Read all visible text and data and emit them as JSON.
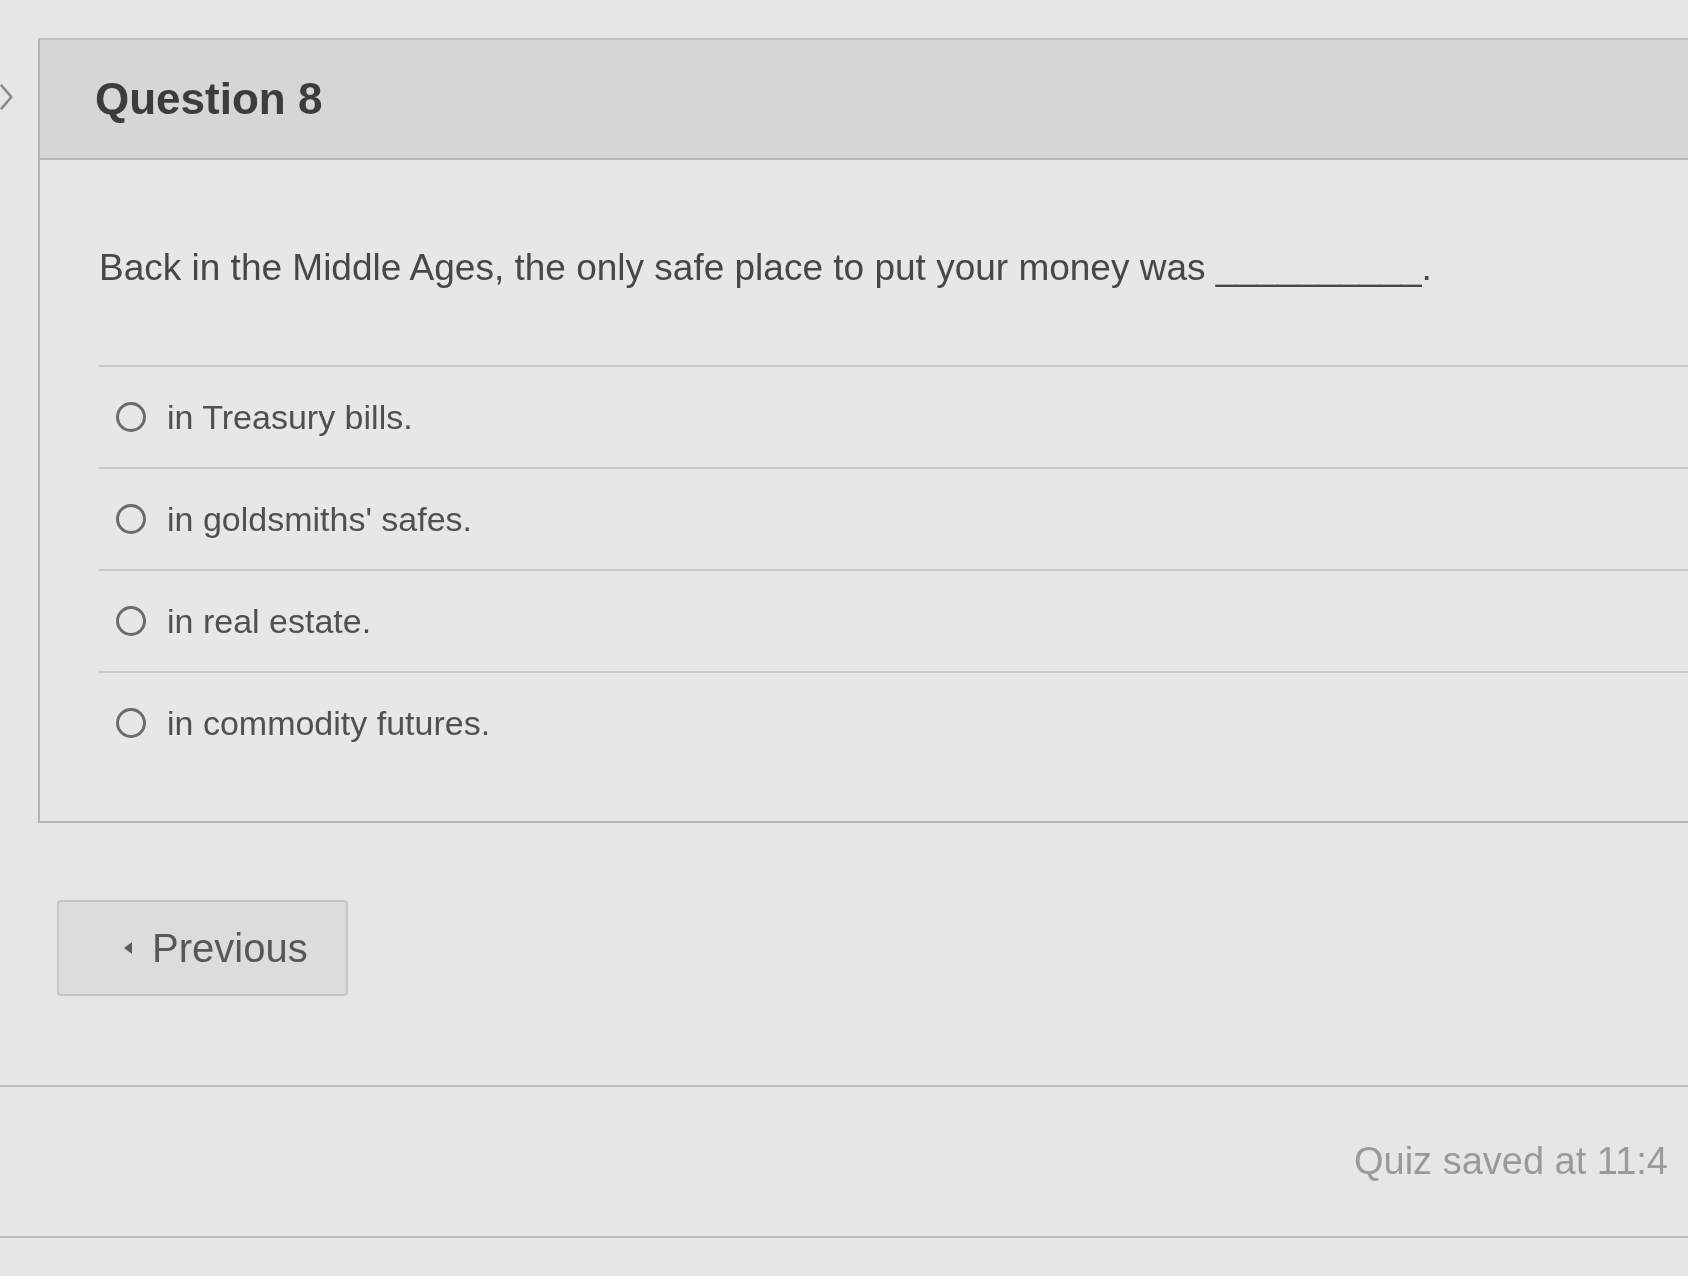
{
  "question": {
    "title": "Question 8",
    "prompt": "Back in the Middle Ages, the only safe place to put your money was __________.",
    "options": [
      {
        "label": "in Treasury bills.",
        "selected": false
      },
      {
        "label": "in goldsmiths' safes.",
        "selected": false
      },
      {
        "label": "in real estate.",
        "selected": false
      },
      {
        "label": "in commodity futures.",
        "selected": false
      }
    ]
  },
  "navigation": {
    "previous": "Previous"
  },
  "status": "Quiz saved at 11:4"
}
